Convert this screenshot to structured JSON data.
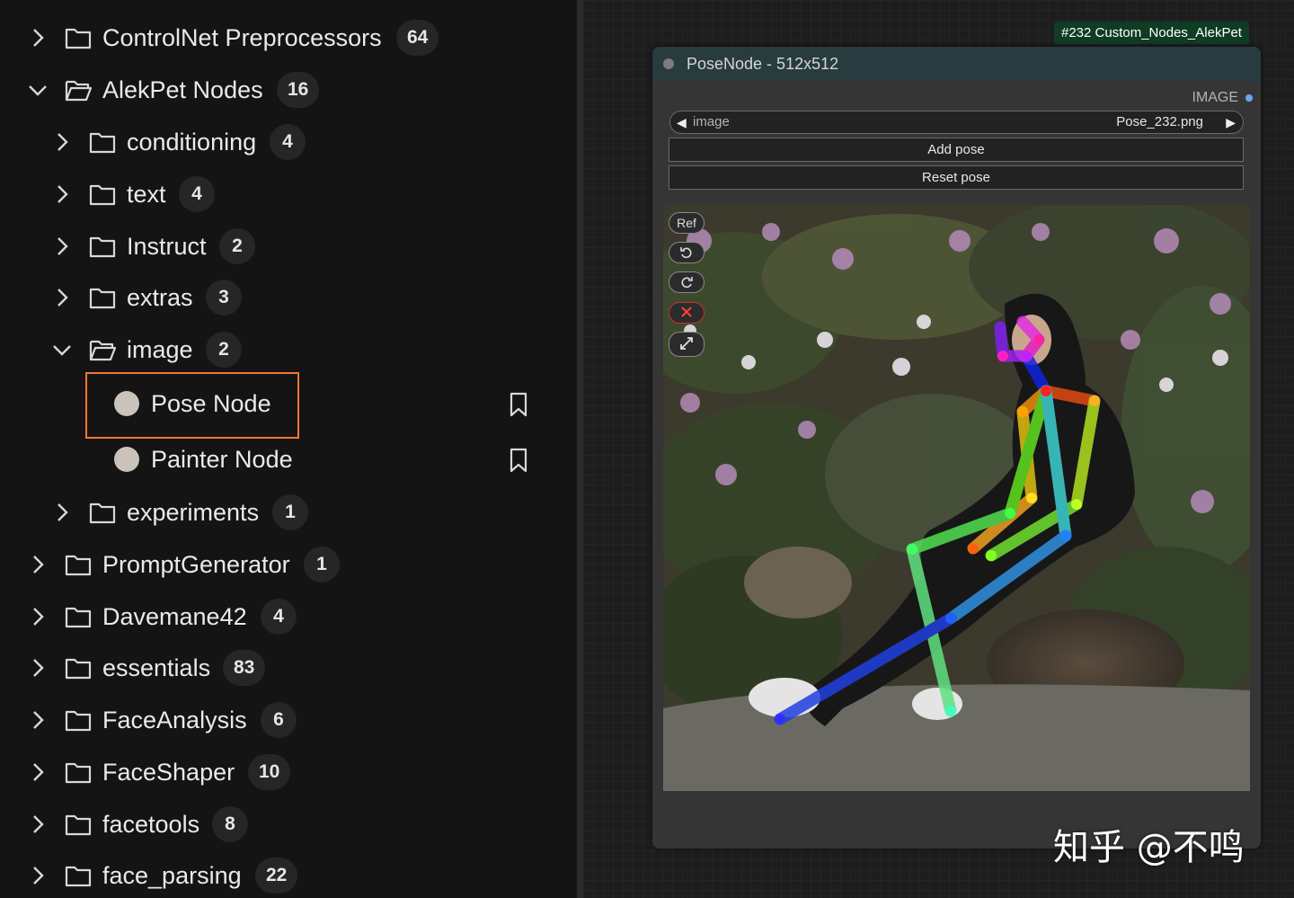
{
  "tree": {
    "items": [
      {
        "label": "ControlNet Preprocessors",
        "count": "64",
        "state": "collapsed"
      },
      {
        "label": "AlekPet Nodes",
        "count": "16",
        "state": "expanded"
      },
      {
        "label": "conditioning",
        "count": "4",
        "state": "collapsed"
      },
      {
        "label": "text",
        "count": "4",
        "state": "collapsed"
      },
      {
        "label": "Instruct",
        "count": "2",
        "state": "collapsed"
      },
      {
        "label": "extras",
        "count": "3",
        "state": "collapsed"
      },
      {
        "label": "image",
        "count": "2",
        "state": "expanded"
      },
      {
        "label": "Pose Node",
        "selected": true
      },
      {
        "label": "Painter Node"
      },
      {
        "label": "experiments",
        "count": "1",
        "state": "collapsed"
      },
      {
        "label": "PromptGenerator",
        "count": "1",
        "state": "collapsed"
      },
      {
        "label": "Davemane42",
        "count": "4",
        "state": "collapsed"
      },
      {
        "label": "essentials",
        "count": "83",
        "state": "collapsed"
      },
      {
        "label": "FaceAnalysis",
        "count": "6",
        "state": "collapsed"
      },
      {
        "label": "FaceShaper",
        "count": "10",
        "state": "collapsed"
      },
      {
        "label": "facetools",
        "count": "8",
        "state": "collapsed"
      },
      {
        "label": "face_parsing",
        "count": "22",
        "state": "collapsed"
      }
    ]
  },
  "node": {
    "id_badge": "#232 Custom_Nodes_AlekPet",
    "title": "PoseNode - 512x512",
    "output_label": "IMAGE",
    "image_widget": {
      "name": "image",
      "value": "Pose_232.png"
    },
    "add_pose": "Add pose",
    "reset_pose": "Reset pose",
    "tools": {
      "ref": "Ref"
    }
  },
  "watermark": "知乎 @不鸣",
  "colors": {
    "selected_outline": "#ef7a2c",
    "node_title_bg": "#283b3f",
    "id_badge_bg": "#0f3d24",
    "output_dot": "#6fa3f5"
  }
}
